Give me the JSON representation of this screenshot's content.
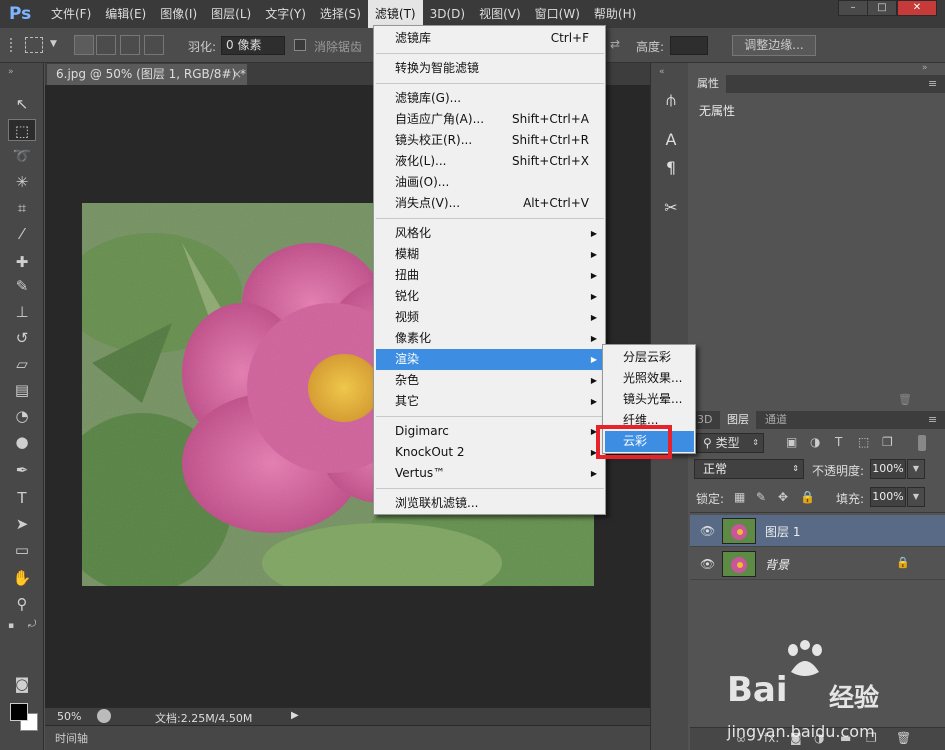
{
  "app": {
    "logo": "Ps"
  },
  "menubar": {
    "items": [
      "文件(F)",
      "编辑(E)",
      "图像(I)",
      "图层(L)",
      "文字(Y)",
      "选择(S)",
      "滤镜(T)",
      "3D(D)",
      "视图(V)",
      "窗口(W)",
      "帮助(H)"
    ],
    "active_index": 6
  },
  "window_controls": {
    "minimize": "–",
    "maximize": "□",
    "close": "✕"
  },
  "options": {
    "feather_label": "羽化:",
    "feather_value": "0 像素",
    "antialias_label": "消除锯齿",
    "height_label": "高度:",
    "refine_edge": "调整边缘..."
  },
  "document": {
    "tab_title": "6.jpg @ 50% (图层 1, RGB/8#) *",
    "tab_close": "×",
    "zoom": "50%",
    "doc_size": "文档:2.25M/4.50M",
    "timeline": "时间轴"
  },
  "filter_menu": {
    "items": [
      {
        "label": "滤镜库",
        "shortcut": "Ctrl+F"
      },
      {
        "sep": true
      },
      {
        "label": "转换为智能滤镜"
      },
      {
        "sep": true
      },
      {
        "label": "滤镜库(G)..."
      },
      {
        "label": "自适应广角(A)...",
        "shortcut": "Shift+Ctrl+A"
      },
      {
        "label": "镜头校正(R)...",
        "shortcut": "Shift+Ctrl+R"
      },
      {
        "label": "液化(L)...",
        "shortcut": "Shift+Ctrl+X"
      },
      {
        "label": "油画(O)..."
      },
      {
        "label": "消失点(V)...",
        "shortcut": "Alt+Ctrl+V"
      },
      {
        "sep": true
      },
      {
        "label": "风格化",
        "submenu": true
      },
      {
        "label": "模糊",
        "submenu": true
      },
      {
        "label": "扭曲",
        "submenu": true
      },
      {
        "label": "锐化",
        "submenu": true
      },
      {
        "label": "视频",
        "submenu": true
      },
      {
        "label": "像素化",
        "submenu": true
      },
      {
        "label": "渲染",
        "submenu": true,
        "selected": true
      },
      {
        "label": "杂色",
        "submenu": true
      },
      {
        "label": "其它",
        "submenu": true
      },
      {
        "sep": true
      },
      {
        "label": "Digimarc",
        "submenu": true
      },
      {
        "label": "KnockOut 2",
        "submenu": true
      },
      {
        "label": "Vertus™",
        "submenu": true
      },
      {
        "sep": true
      },
      {
        "label": "浏览联机滤镜..."
      }
    ]
  },
  "render_submenu": {
    "items": [
      {
        "label": "分层云彩"
      },
      {
        "label": "光照效果..."
      },
      {
        "label": "镜头光晕..."
      },
      {
        "label": "纤维..."
      },
      {
        "label": "云彩",
        "selected": true
      }
    ]
  },
  "properties_panel": {
    "tab": "属性",
    "empty_text": "无属性",
    "collapse": "»",
    "menu": "≡"
  },
  "layers_panel": {
    "tabs": [
      "3D",
      "图层",
      "通道"
    ],
    "active_tab": 1,
    "filter_label": "类型",
    "blend_mode": "正常",
    "opacity_label": "不透明度:",
    "opacity_value": "100%",
    "lock_label": "锁定:",
    "fill_label": "填充:",
    "fill_value": "100%",
    "layers": [
      {
        "name": "图层 1",
        "selected": true,
        "locked": false
      },
      {
        "name": "背景",
        "selected": false,
        "locked": true
      }
    ],
    "footer_fx": "fx."
  },
  "watermark": {
    "bai": "Bai",
    "jingyan": "经验",
    "url": "jingyan.baidu.com"
  },
  "colors": {
    "menu_highlight": "#3d8ee3",
    "highlight_border": "#e8222b",
    "selected_layer": "#586a85"
  }
}
